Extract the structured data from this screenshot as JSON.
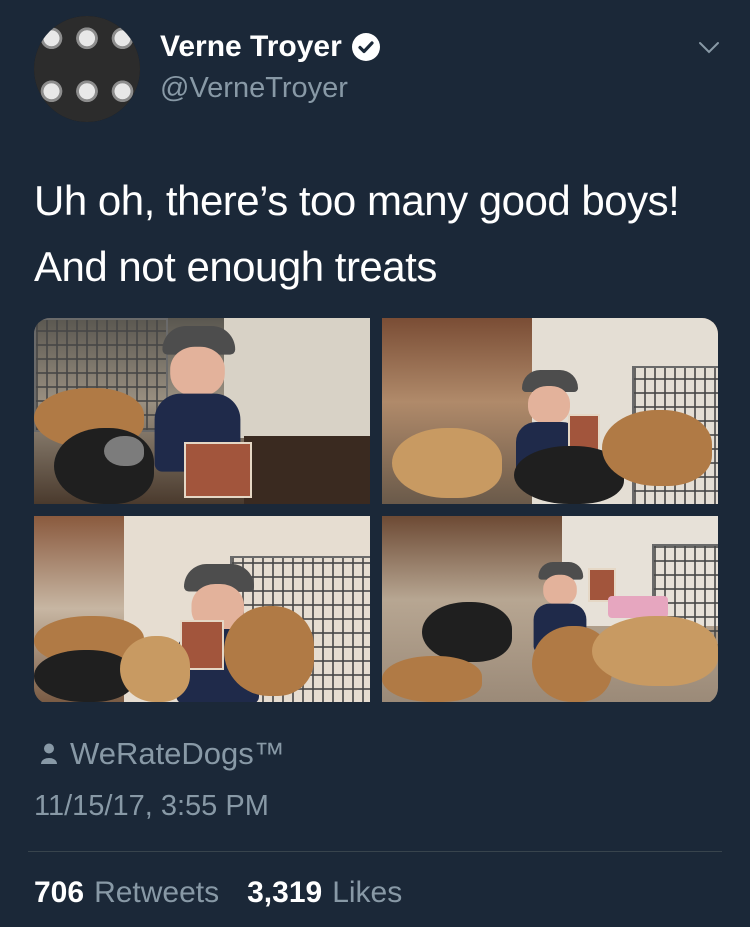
{
  "author": {
    "display_name": "Verne Troyer",
    "handle": "@VerneTroyer",
    "avatar_icon": "avatar-photo-grid",
    "verified_icon": "verified-badge-icon"
  },
  "menu_icon": "chevron-down-icon",
  "tweet": {
    "lines": [
      "Uh oh, there’s too many good boys!",
      "And not enough treats"
    ]
  },
  "media": {
    "photos": [
      {
        "label": "photo 1"
      },
      {
        "label": "photo 2"
      },
      {
        "label": "photo 3"
      },
      {
        "label": "photo 4"
      }
    ]
  },
  "source": {
    "icon": "person-icon",
    "label": "WeRateDogs™"
  },
  "timestamp": "11/15/17, 3:55 PM",
  "stats": {
    "retweets_count": "706",
    "retweets_label": "Retweets",
    "likes_count": "3,319",
    "likes_label": "Likes"
  },
  "colors": {
    "background": "#1b2838",
    "text_primary": "#ffffff",
    "text_secondary": "#8899a6",
    "divider": "#38444d"
  }
}
